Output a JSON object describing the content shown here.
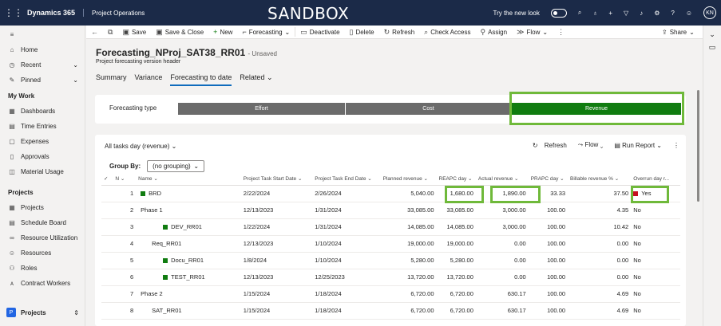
{
  "topbar": {
    "app_name": "Dynamics 365",
    "area_name": "Project Operations",
    "env_label": "SANDBOX",
    "new_look_label": "Try the new look",
    "avatar_initials": "KN"
  },
  "sidebar": {
    "items": [
      {
        "label": "Home",
        "icon": "home-icon"
      },
      {
        "label": "Recent",
        "icon": "clock-icon"
      },
      {
        "label": "Pinned",
        "icon": "pin-icon"
      }
    ],
    "section_mywork": "My Work",
    "mywork_items": [
      {
        "label": "Dashboards"
      },
      {
        "label": "Time Entries"
      },
      {
        "label": "Expenses"
      },
      {
        "label": "Approvals"
      },
      {
        "label": "Material Usage"
      }
    ],
    "section_projects": "Projects",
    "project_items": [
      {
        "label": "Projects"
      },
      {
        "label": "Schedule Board"
      },
      {
        "label": "Resource Utilization"
      },
      {
        "label": "Resources"
      },
      {
        "label": "Roles"
      },
      {
        "label": "Contract Workers"
      }
    ],
    "area_switcher": {
      "badge": "P",
      "label": "Projects"
    }
  },
  "commands": {
    "save": "Save",
    "save_close": "Save & Close",
    "new": "New",
    "forecasting": "Forecasting",
    "deactivate": "Deactivate",
    "delete": "Delete",
    "refresh": "Refresh",
    "check_access": "Check Access",
    "assign": "Assign",
    "flow": "Flow",
    "share": "Share"
  },
  "record": {
    "title": "Forecasting_NProj_SAT38_RR01",
    "status": "- Unsaved",
    "entity": "Project forecasting version header"
  },
  "tabs": [
    "Summary",
    "Variance",
    "Forecasting to date",
    "Related"
  ],
  "active_tab": "Forecasting to date",
  "forecasting_type": {
    "label": "Forecasting type",
    "options": [
      "Effort",
      "Cost",
      "Revenue"
    ],
    "selected": "Revenue"
  },
  "grid": {
    "view_name": "All tasks day (revenue)",
    "refresh": "Refresh",
    "flow": "Flow",
    "run_report": "Run Report",
    "group_by_label": "Group By:",
    "group_by_value": "(no grouping)",
    "columns": [
      "N",
      "Name",
      "Project Task Start Date",
      "Project Task End Date",
      "Planned revenue",
      "REAPC day",
      "Actual revenue",
      "PRAPC day",
      "Billable revenue %",
      "Overrun day r..."
    ],
    "rows": [
      {
        "n": "1",
        "name": "BRD",
        "indent": 0,
        "marker": "green",
        "start": "2/22/2024",
        "end": "2/26/2024",
        "planned": "5,040.00",
        "reapc": "1,680.00",
        "actual": "1,890.00",
        "prapc": "33.33",
        "billable": "37.50",
        "overrun": "Yes",
        "overrun_marker": "red"
      },
      {
        "n": "2",
        "name": "Phase 1",
        "indent": 0,
        "marker": "",
        "start": "12/13/2023",
        "end": "1/31/2024",
        "planned": "33,085.00",
        "reapc": "33,085.00",
        "actual": "3,000.00",
        "prapc": "100.00",
        "billable": "4.35",
        "overrun": "No",
        "overrun_marker": ""
      },
      {
        "n": "3",
        "name": "DEV_RR01",
        "indent": 2,
        "marker": "green",
        "start": "1/22/2024",
        "end": "1/31/2024",
        "planned": "14,085.00",
        "reapc": "14,085.00",
        "actual": "3,000.00",
        "prapc": "100.00",
        "billable": "10.42",
        "overrun": "No",
        "overrun_marker": ""
      },
      {
        "n": "4",
        "name": "Req_RR01",
        "indent": 1,
        "marker": "",
        "start": "12/13/2023",
        "end": "1/10/2024",
        "planned": "19,000.00",
        "reapc": "19,000.00",
        "actual": "0.00",
        "prapc": "100.00",
        "billable": "0.00",
        "overrun": "No",
        "overrun_marker": ""
      },
      {
        "n": "5",
        "name": "Docu_RR01",
        "indent": 2,
        "marker": "green",
        "start": "1/8/2024",
        "end": "1/10/2024",
        "planned": "5,280.00",
        "reapc": "5,280.00",
        "actual": "0.00",
        "prapc": "100.00",
        "billable": "0.00",
        "overrun": "No",
        "overrun_marker": ""
      },
      {
        "n": "6",
        "name": "TEST_RR01",
        "indent": 2,
        "marker": "green",
        "start": "12/13/2023",
        "end": "12/25/2023",
        "planned": "13,720.00",
        "reapc": "13,720.00",
        "actual": "0.00",
        "prapc": "100.00",
        "billable": "0.00",
        "overrun": "No",
        "overrun_marker": ""
      },
      {
        "n": "7",
        "name": "Phase 2",
        "indent": 0,
        "marker": "",
        "start": "1/15/2024",
        "end": "1/18/2024",
        "planned": "6,720.00",
        "reapc": "6,720.00",
        "actual": "630.17",
        "prapc": "100.00",
        "billable": "4.69",
        "overrun": "No",
        "overrun_marker": ""
      },
      {
        "n": "8",
        "name": "SAT_RR01",
        "indent": 1,
        "marker": "",
        "start": "1/15/2024",
        "end": "1/18/2024",
        "planned": "6,720.00",
        "reapc": "6,720.00",
        "actual": "630.17",
        "prapc": "100.00",
        "billable": "4.69",
        "overrun": "No",
        "overrun_marker": ""
      }
    ]
  },
  "colors": {
    "topbar": "#1b2a48",
    "accent": "#0f6cbd",
    "selected_segment": "#107c10",
    "highlight": "#6fb93a",
    "overrun_red": "#c50f1f"
  }
}
